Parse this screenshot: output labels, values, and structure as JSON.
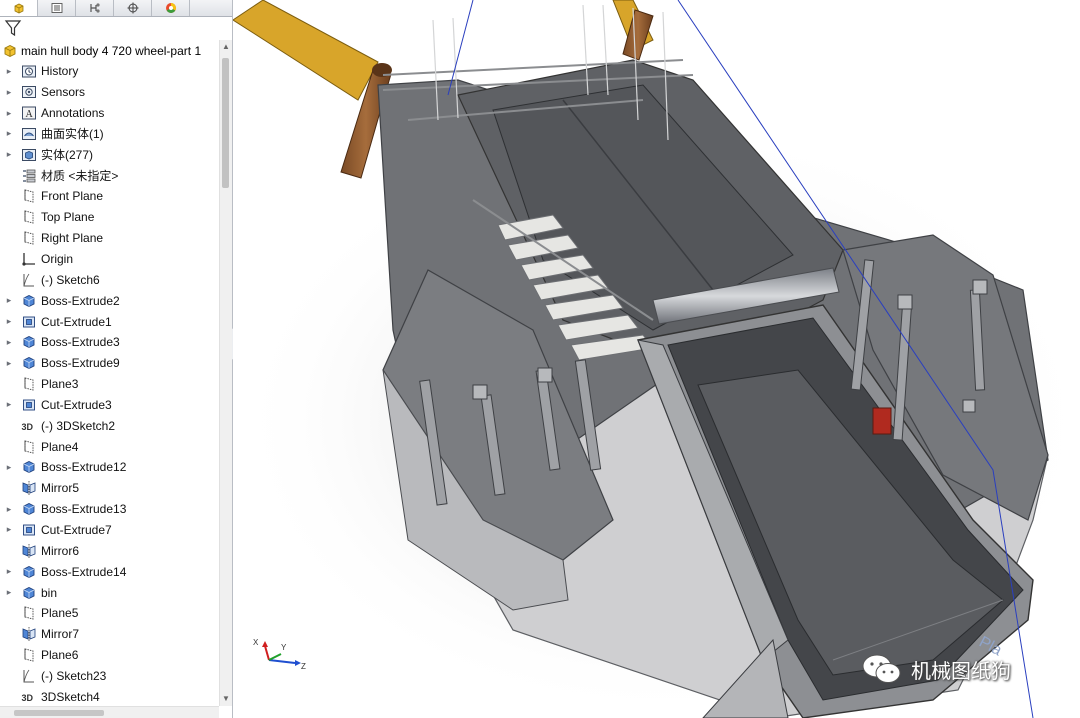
{
  "panel": {
    "tabs": [
      {
        "name": "feature-manager",
        "icon": "feature-tree-icon"
      },
      {
        "name": "property-manager",
        "icon": "property-list-icon"
      },
      {
        "name": "configuration-manager",
        "icon": "configuration-icon"
      },
      {
        "name": "dimxpert-manager",
        "icon": "crosshair-icon"
      },
      {
        "name": "display-manager",
        "icon": "color-wheel-icon"
      }
    ],
    "filter_icon": "filter-icon",
    "root_label": "main hull body 4 720 wheel-part 1",
    "tree": [
      {
        "label": "History",
        "icon": "history-folder-icon",
        "expandable": true
      },
      {
        "label": "Sensors",
        "icon": "sensor-icon",
        "expandable": true
      },
      {
        "label": "Annotations",
        "icon": "annotations-icon",
        "expandable": true
      },
      {
        "label": "曲面实体(1)",
        "icon": "surface-bodies-icon",
        "expandable": true
      },
      {
        "label": "实体(277)",
        "icon": "solid-bodies-icon",
        "expandable": true
      },
      {
        "label": "材质 <未指定>",
        "icon": "material-icon",
        "expandable": false
      },
      {
        "label": "Front Plane",
        "icon": "plane-icon",
        "expandable": false
      },
      {
        "label": "Top Plane",
        "icon": "plane-icon",
        "expandable": false
      },
      {
        "label": "Right Plane",
        "icon": "plane-icon",
        "expandable": false
      },
      {
        "label": "Origin",
        "icon": "origin-icon",
        "expandable": false
      },
      {
        "label": "(-) Sketch6",
        "icon": "sketch-icon",
        "expandable": false
      },
      {
        "label": "Boss-Extrude2",
        "icon": "boss-extrude-icon",
        "expandable": true
      },
      {
        "label": "Cut-Extrude1",
        "icon": "cut-extrude-icon",
        "expandable": true
      },
      {
        "label": "Boss-Extrude3",
        "icon": "boss-extrude-icon",
        "expandable": true
      },
      {
        "label": "Boss-Extrude9",
        "icon": "boss-extrude-icon",
        "expandable": true
      },
      {
        "label": "Plane3",
        "icon": "plane-icon",
        "expandable": false
      },
      {
        "label": "Cut-Extrude3",
        "icon": "cut-extrude-icon",
        "expandable": true
      },
      {
        "label": "(-) 3DSketch2",
        "icon": "3d-sketch-icon",
        "expandable": false
      },
      {
        "label": "Plane4",
        "icon": "plane-icon",
        "expandable": false
      },
      {
        "label": "Boss-Extrude12",
        "icon": "boss-extrude-icon",
        "expandable": true
      },
      {
        "label": "Mirror5",
        "icon": "mirror-icon",
        "expandable": false
      },
      {
        "label": "Boss-Extrude13",
        "icon": "boss-extrude-icon",
        "expandable": true
      },
      {
        "label": "Cut-Extrude7",
        "icon": "cut-extrude-icon",
        "expandable": true
      },
      {
        "label": "Mirror6",
        "icon": "mirror-icon",
        "expandable": false
      },
      {
        "label": "Boss-Extrude14",
        "icon": "boss-extrude-icon",
        "expandable": true
      },
      {
        "label": "bin",
        "icon": "boss-extrude-icon",
        "expandable": true
      },
      {
        "label": "Plane5",
        "icon": "plane-icon",
        "expandable": false
      },
      {
        "label": "Mirror7",
        "icon": "mirror-icon",
        "expandable": false
      },
      {
        "label": "Plane6",
        "icon": "plane-icon",
        "expandable": false
      },
      {
        "label": "(-) Sketch23",
        "icon": "sketch-icon",
        "expandable": false
      },
      {
        "label": "3DSketch4",
        "icon": "3d-sketch-icon",
        "expandable": false
      }
    ]
  },
  "viewport": {
    "triad_axes": {
      "x": "X",
      "y": "Y",
      "z": "Z"
    },
    "plane_label": "Pla",
    "watermark": {
      "icon": "wechat-icon",
      "text": "机械图纸狗"
    }
  }
}
